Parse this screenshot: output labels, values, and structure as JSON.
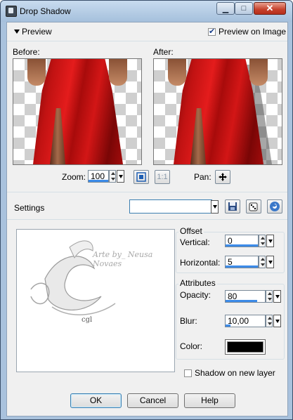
{
  "window": {
    "title": "Drop Shadow",
    "min_label": "▁",
    "max_label": "□",
    "close_label": "✕"
  },
  "preview": {
    "header_label": "Preview",
    "preview_on_image_label": "Preview on Image",
    "preview_on_image_checked": true,
    "before_label": "Before:",
    "after_label": "After:",
    "zoom_label": "Zoom:",
    "zoom_value": "100",
    "zoom_1to1_label": "1:1",
    "pan_label": "Pan:"
  },
  "settings": {
    "label": "Settings",
    "preset_value": ""
  },
  "sample": {
    "watermark_text": "Arte by_ Neusa Novaes",
    "signature_text": "cgl"
  },
  "offset": {
    "title": "Offset",
    "vertical_label": "Vertical:",
    "vertical_value": "0",
    "horizontal_label": "Horizontal:",
    "horizontal_value": "5"
  },
  "attributes": {
    "title": "Attributes",
    "opacity_label": "Opacity:",
    "opacity_value": "80",
    "blur_label": "Blur:",
    "blur_value": "10,00",
    "color_label": "Color:",
    "color_value": "#000000"
  },
  "shadow_new_layer": {
    "label": "Shadow on new layer",
    "checked": false
  },
  "buttons": {
    "ok": "OK",
    "cancel": "Cancel",
    "help": "Help"
  },
  "colors": {
    "accent": "#3c8be8",
    "title_bar": "#b9cfe6",
    "close": "#c5402b"
  }
}
